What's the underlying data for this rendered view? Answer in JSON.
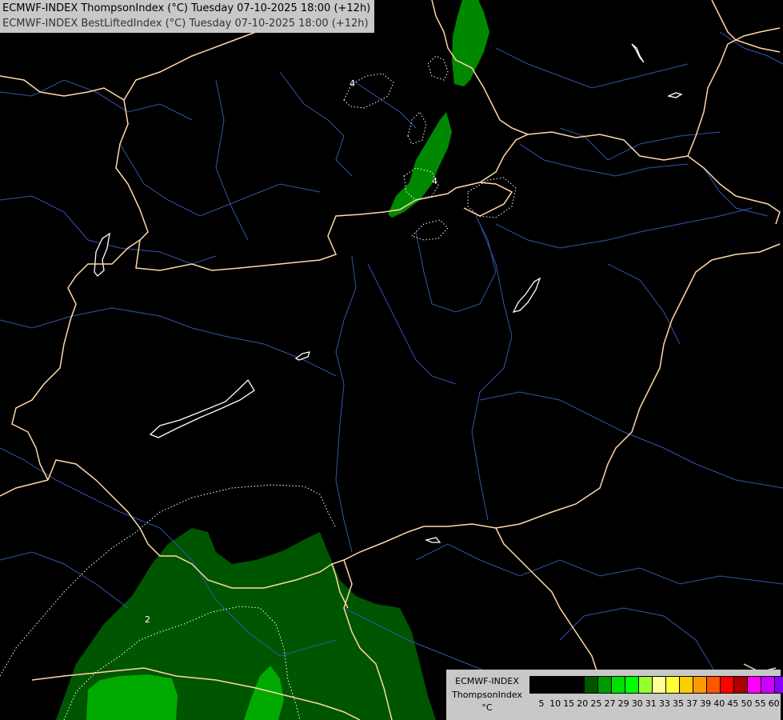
{
  "title": {
    "line1": "ECMWF-INDEX ThompsonIndex (°C) Tuesday 07-10-2025 18:00 (+12h)",
    "line2": "ECMWF-INDEX BestLiftedIndex (°C) Tuesday 07-10-2025 18:00 (+12h)"
  },
  "map": {
    "contour_labels": [
      "4",
      "4",
      "2"
    ]
  },
  "legend": {
    "model": "ECMWF-INDEX",
    "parameter": "ThompsonIndex",
    "unit": "°C",
    "ticks": [
      "5",
      "10",
      "15",
      "20",
      "25",
      "27",
      "29",
      "30",
      "31",
      "33",
      "35",
      "37",
      "39",
      "40",
      "45",
      "50",
      "55",
      "60"
    ],
    "colors": [
      "#000000",
      "#000000",
      "#000000",
      "#000000",
      "#005500",
      "#009900",
      "#00dd00",
      "#00ff00",
      "#99ff33",
      "#ffff99",
      "#ffff33",
      "#ffcc00",
      "#ff9900",
      "#ff5500",
      "#ff0000",
      "#aa0000",
      "#ff00ff",
      "#cc00ff",
      "#8800ff",
      "#0000ff"
    ]
  }
}
